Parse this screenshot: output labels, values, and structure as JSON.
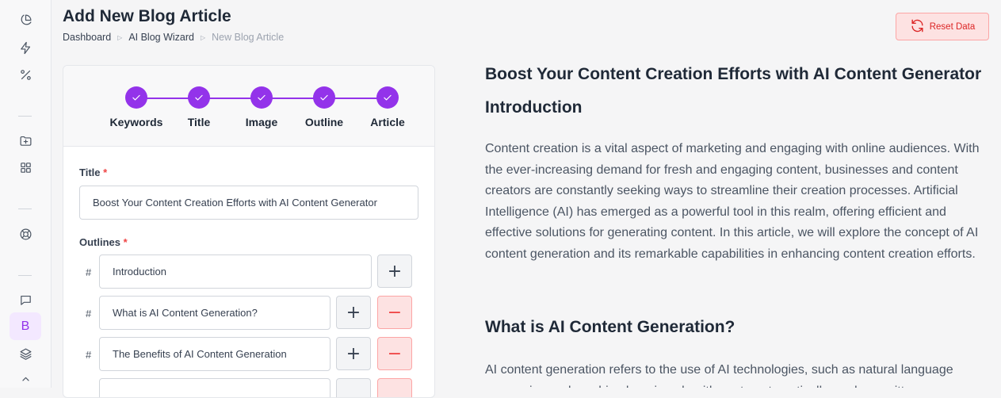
{
  "sidebar": {
    "icons": [
      "pie-chart-icon",
      "lightning-icon",
      "percent-icon",
      "folder-plus-icon",
      "grid-icon",
      "lifebuoy-icon",
      "chat-icon",
      "brand-b-icon",
      "layers-icon"
    ],
    "active_letter": "B"
  },
  "header": {
    "title": "Add New Blog Article",
    "breadcrumb": [
      "Dashboard",
      "AI Blog Wizard",
      "New Blog Article"
    ],
    "reset_label": "Reset Data"
  },
  "wizard": {
    "steps": [
      "Keywords",
      "Title",
      "Image",
      "Outline",
      "Article"
    ],
    "title_label": "Title",
    "required_mark": "*",
    "title_value": "Boost Your Content Creation Efforts with AI Content Generator",
    "outlines_label": "Outlines",
    "hash": "#",
    "outlines": [
      "Introduction",
      "What is AI Content Generation?",
      "The Benefits of AI Content Generation",
      ""
    ]
  },
  "article": {
    "title": "Boost Your Content Creation Efforts with AI Content Generator",
    "h2_intro": "Introduction",
    "intro_paragraph": "Content creation is a vital aspect of marketing and engaging with online audiences. With the ever-increasing demand for fresh and engaging content, businesses and content creators are constantly seeking ways to streamline their creation processes. Artificial Intelligence (AI) has emerged as a powerful tool in this realm, offering efficient and effective solutions for generating content. In this article, we will explore the concept of AI content generation and its remarkable capabilities in enhancing content creation efforts.",
    "h2_what": "What is AI Content Generation?",
    "what_paragraph": "AI content generation refers to the use of AI technologies, such as natural language processing and machine learning algorithms, to automatically produce written"
  },
  "colors": {
    "accent": "#9333ea",
    "danger": "#ef4444",
    "danger_bg": "#fde2e2"
  }
}
